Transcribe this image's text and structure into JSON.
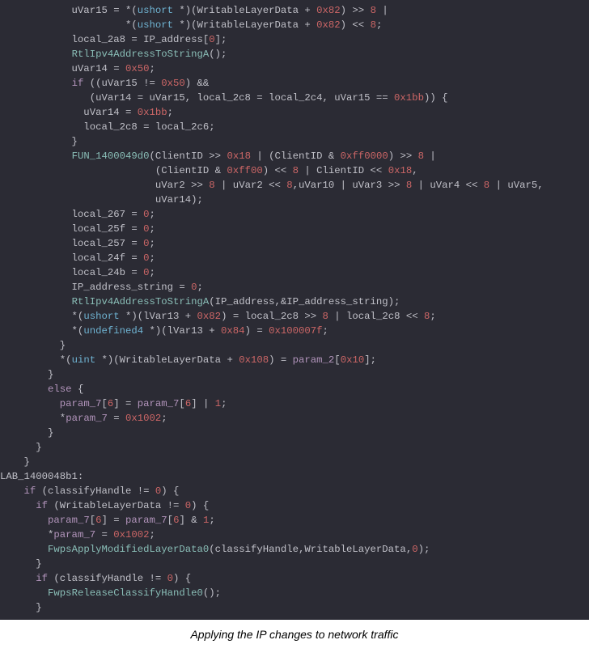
{
  "caption": "Applying the IP changes to network traffic",
  "code": {
    "line01": {
      "a": "            uVar15 = *(",
      "b": "ushort",
      "c": " *)(WritableLayerData + ",
      "d": "0x82",
      "e": ") >> ",
      "f": "8",
      "g": " |"
    },
    "line02": {
      "a": "                     *(",
      "b": "ushort",
      "c": " *)(WritableLayerData + ",
      "d": "0x82",
      "e": ") << ",
      "f": "8",
      "g": ";"
    },
    "line03": {
      "a": "            local_2a8 = IP_address[",
      "b": "0",
      "c": "];"
    },
    "line04": {
      "a": "            ",
      "b": "RtlIpv4AddressToStringA",
      "c": "();"
    },
    "line05": {
      "a": "            uVar14 = ",
      "b": "0x50",
      "c": ";"
    },
    "line06": {
      "a": "            ",
      "b": "if",
      "c": " ((uVar15 != ",
      "d": "0x50",
      "e": ") &&"
    },
    "line07": {
      "a": "               (uVar14 = uVar15, local_2c8 = local_2c4, uVar15 == ",
      "b": "0x1bb",
      "c": ")) {"
    },
    "line08": {
      "a": "              uVar14 = ",
      "b": "0x1bb",
      "c": ";"
    },
    "line09": {
      "a": "              local_2c8 = local_2c6;"
    },
    "line10": {
      "a": "            }"
    },
    "line11": {
      "a": "            ",
      "b": "FUN_1400049d0",
      "c": "(ClientID >> ",
      "d": "0x18",
      "e": " | (ClientID & ",
      "f": "0xff0000",
      "g": ") >> ",
      "h": "8",
      "i": " |"
    },
    "line12": {
      "a": "                          (ClientID & ",
      "b": "0xff00",
      "c": ") << ",
      "d": "8",
      "e": " | ClientID << ",
      "f": "0x18",
      "g": ","
    },
    "line13": {
      "a": "                          uVar2 >> ",
      "b": "8",
      "c": " | uVar2 << ",
      "d": "8",
      "e": ",uVar10 | uVar3 >> ",
      "f": "8",
      "g": " | uVar4 << ",
      "h": "8",
      "i": " | uVar5,"
    },
    "line14": {
      "a": "                          uVar14);"
    },
    "line15": {
      "a": "            local_267 = ",
      "b": "0",
      "c": ";"
    },
    "line16": {
      "a": "            local_25f = ",
      "b": "0",
      "c": ";"
    },
    "line17": {
      "a": "            local_257 = ",
      "b": "0",
      "c": ";"
    },
    "line18": {
      "a": "            local_24f = ",
      "b": "0",
      "c": ";"
    },
    "line19": {
      "a": "            local_24b = ",
      "b": "0",
      "c": ";"
    },
    "line20": {
      "a": "            IP_address_string = ",
      "b": "0",
      "c": ";"
    },
    "line21": {
      "a": "            ",
      "b": "RtlIpv4AddressToStringA",
      "c": "(IP_address,&IP_address_string);"
    },
    "line22": {
      "a": "            *(",
      "b": "ushort",
      "c": " *)(lVar13 + ",
      "d": "0x82",
      "e": ") = local_2c8 >> ",
      "f": "8",
      "g": " | local_2c8 << ",
      "h": "8",
      "i": ";"
    },
    "line23": {
      "a": "            *(",
      "b": "undefined4",
      "c": " *)(lVar13 + ",
      "d": "0x84",
      "e": ") = ",
      "f": "0x100007f",
      "g": ";"
    },
    "line24": {
      "a": "          }"
    },
    "line25": {
      "a": "          *(",
      "b": "uint",
      "c": " *)(WritableLayerData + ",
      "d": "0x108",
      "e": ") = ",
      "f": "param_2",
      "g": "[",
      "h": "0x10",
      "i": "];"
    },
    "line26": {
      "a": "        }"
    },
    "line27": {
      "a": "        ",
      "b": "else",
      "c": " {"
    },
    "line28": {
      "a": "          ",
      "b": "param_7",
      "c": "[",
      "d": "6",
      "e": "] = ",
      "f": "param_7",
      "g": "[",
      "h": "6",
      "i": "] | ",
      "j": "1",
      "k": ";"
    },
    "line29": {
      "a": "          *",
      "b": "param_7",
      "c": " = ",
      "d": "0x1002",
      "e": ";"
    },
    "line30": {
      "a": "        }"
    },
    "line31": {
      "a": "      }"
    },
    "line32": {
      "a": "    }"
    },
    "line33": {
      "a": "LAB_1400048b1:"
    },
    "line34": {
      "a": "    ",
      "b": "if",
      "c": " (classifyHandle != ",
      "d": "0",
      "e": ") {"
    },
    "line35": {
      "a": "      ",
      "b": "if",
      "c": " (WritableLayerData != ",
      "d": "0",
      "e": ") {"
    },
    "line36": {
      "a": "        ",
      "b": "param_7",
      "c": "[",
      "d": "6",
      "e": "] = ",
      "f": "param_7",
      "g": "[",
      "h": "6",
      "i": "] & ",
      "j": "1",
      "k": ";"
    },
    "line37": {
      "a": "        *",
      "b": "param_7",
      "c": " = ",
      "d": "0x1002",
      "e": ";"
    },
    "line38": {
      "a": "        ",
      "b": "FwpsApplyModifiedLayerData0",
      "c": "(classifyHandle,WritableLayerData,",
      "d": "0",
      "e": ");"
    },
    "line39": {
      "a": "      }"
    },
    "line40": {
      "a": "      ",
      "b": "if",
      "c": " (classifyHandle != ",
      "d": "0",
      "e": ") {"
    },
    "line41": {
      "a": "        ",
      "b": "FwpsReleaseClassifyHandle0",
      "c": "();"
    },
    "line42": {
      "a": "      }"
    }
  }
}
